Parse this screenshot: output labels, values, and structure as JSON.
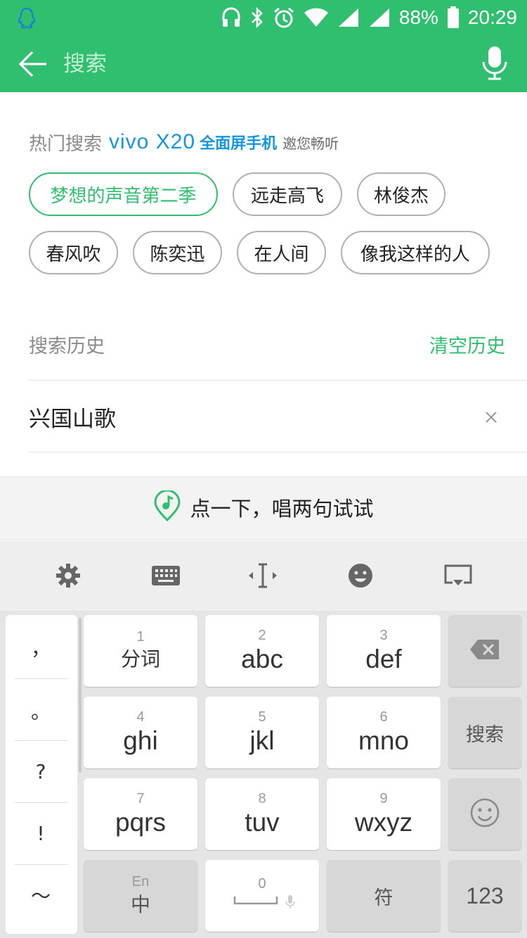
{
  "status_bar": {
    "battery_percent": "88%",
    "time": "20:29"
  },
  "search": {
    "placeholder": "搜索"
  },
  "hot_search": {
    "title": "热门搜索",
    "sponsor_logo": "vivo X20",
    "sponsor_tagline": "全面屏手机",
    "sponsor_invite": "邀您畅听",
    "chips": [
      "梦想的声音第二季",
      "远走高飞",
      "林俊杰",
      "春风吹",
      "陈奕迅",
      "在人间",
      "像我这样的人"
    ]
  },
  "history": {
    "title": "搜索历史",
    "clear_label": "清空历史",
    "items": [
      "兴国山歌"
    ]
  },
  "keyboard": {
    "sing_prompt": "点一下，唱两句试试",
    "punctuation": [
      "，",
      "。",
      "?",
      "!",
      "～"
    ],
    "keys": {
      "k1": {
        "num": "1",
        "label": "分词"
      },
      "k2": {
        "num": "2",
        "label": "abc"
      },
      "k3": {
        "num": "3",
        "label": "def"
      },
      "k4": {
        "num": "4",
        "label": "ghi"
      },
      "k5": {
        "num": "5",
        "label": "jkl"
      },
      "k6": {
        "num": "6",
        "label": "mno"
      },
      "k7": {
        "num": "7",
        "label": "pqrs"
      },
      "k8": {
        "num": "8",
        "label": "tuv"
      },
      "k9": {
        "num": "9",
        "label": "wxyz"
      },
      "lang": {
        "top": "En",
        "label": "中"
      },
      "space": {
        "num": "0"
      },
      "symbol": "符",
      "numeric": "123",
      "search": "搜索"
    }
  }
}
